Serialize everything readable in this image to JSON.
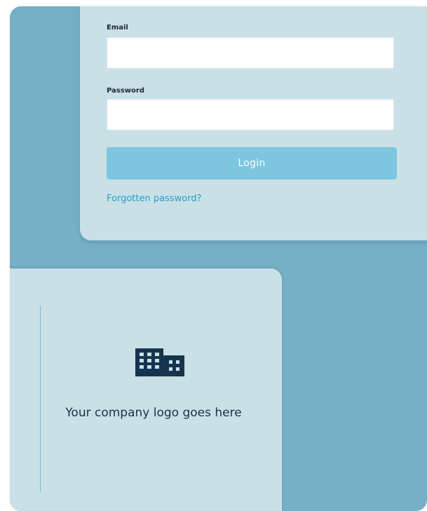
{
  "login_form": {
    "email_label": "Email",
    "email_value": "",
    "email_placeholder": "",
    "password_label": "Password",
    "password_value": "",
    "password_placeholder": "",
    "login_button_label": "Login",
    "forgot_password_label": "Forgotten password?"
  },
  "logo_panel": {
    "icon": "building-icon",
    "caption": "Your company logo goes here"
  },
  "colors": {
    "background": "#76b0c6",
    "card": "#c9e0e7",
    "button": "#7cc6e0",
    "link": "#2a9cc9",
    "logo_icon": "#16334f"
  }
}
